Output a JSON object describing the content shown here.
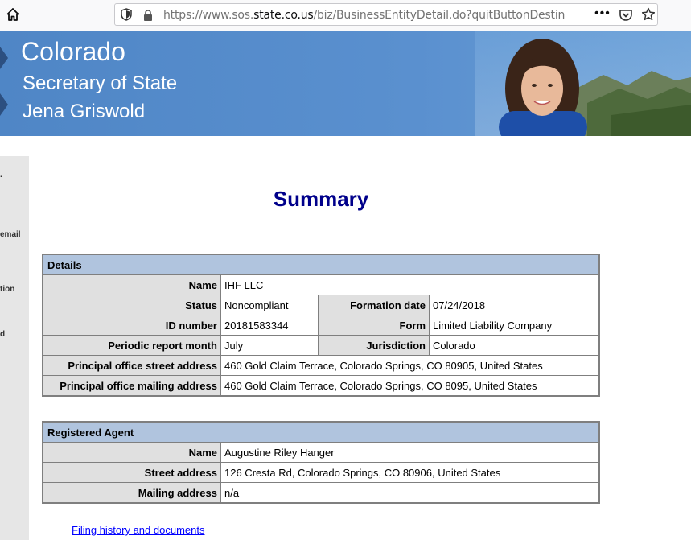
{
  "browser": {
    "url_prefix": "https://www.sos.",
    "url_domain": "state.co.us",
    "url_path": "/biz/BusinessEntityDetail.do?quitButtonDestination=Bu",
    "menu_dots": "•••"
  },
  "banner": {
    "line1": "Colorado",
    "line2": "Secretary of State",
    "line3": "Jena Griswold"
  },
  "sidebar": {
    "items": [
      ".",
      "email",
      "tion",
      "d"
    ]
  },
  "page": {
    "title": "Summary",
    "link": "Filing history and documents"
  },
  "details": {
    "header": "Details",
    "name_label": "Name",
    "name": "IHF LLC",
    "status_label": "Status",
    "status": "Noncompliant",
    "formation_label": "Formation date",
    "formation": "07/24/2018",
    "id_label": "ID number",
    "id": "20181583344",
    "form_label": "Form",
    "form": "Limited Liability Company",
    "periodic_label": "Periodic report month",
    "periodic": "July",
    "jurisdiction_label": "Jurisdiction",
    "jurisdiction": "Colorado",
    "street_label": "Principal office street address",
    "street": "460 Gold Claim Terrace, Colorado Springs, CO 80905, United States",
    "mailing_label": "Principal office mailing address",
    "mailing": "460 Gold Claim Terrace, Colorado Springs, CO 8095, United States"
  },
  "agent": {
    "header": "Registered Agent",
    "name_label": "Name",
    "name": "Augustine Riley Hanger",
    "street_label": "Street address",
    "street": "126 Cresta Rd, Colorado Springs, CO 80906, United States",
    "mailing_label": "Mailing address",
    "mailing": "n/a"
  }
}
